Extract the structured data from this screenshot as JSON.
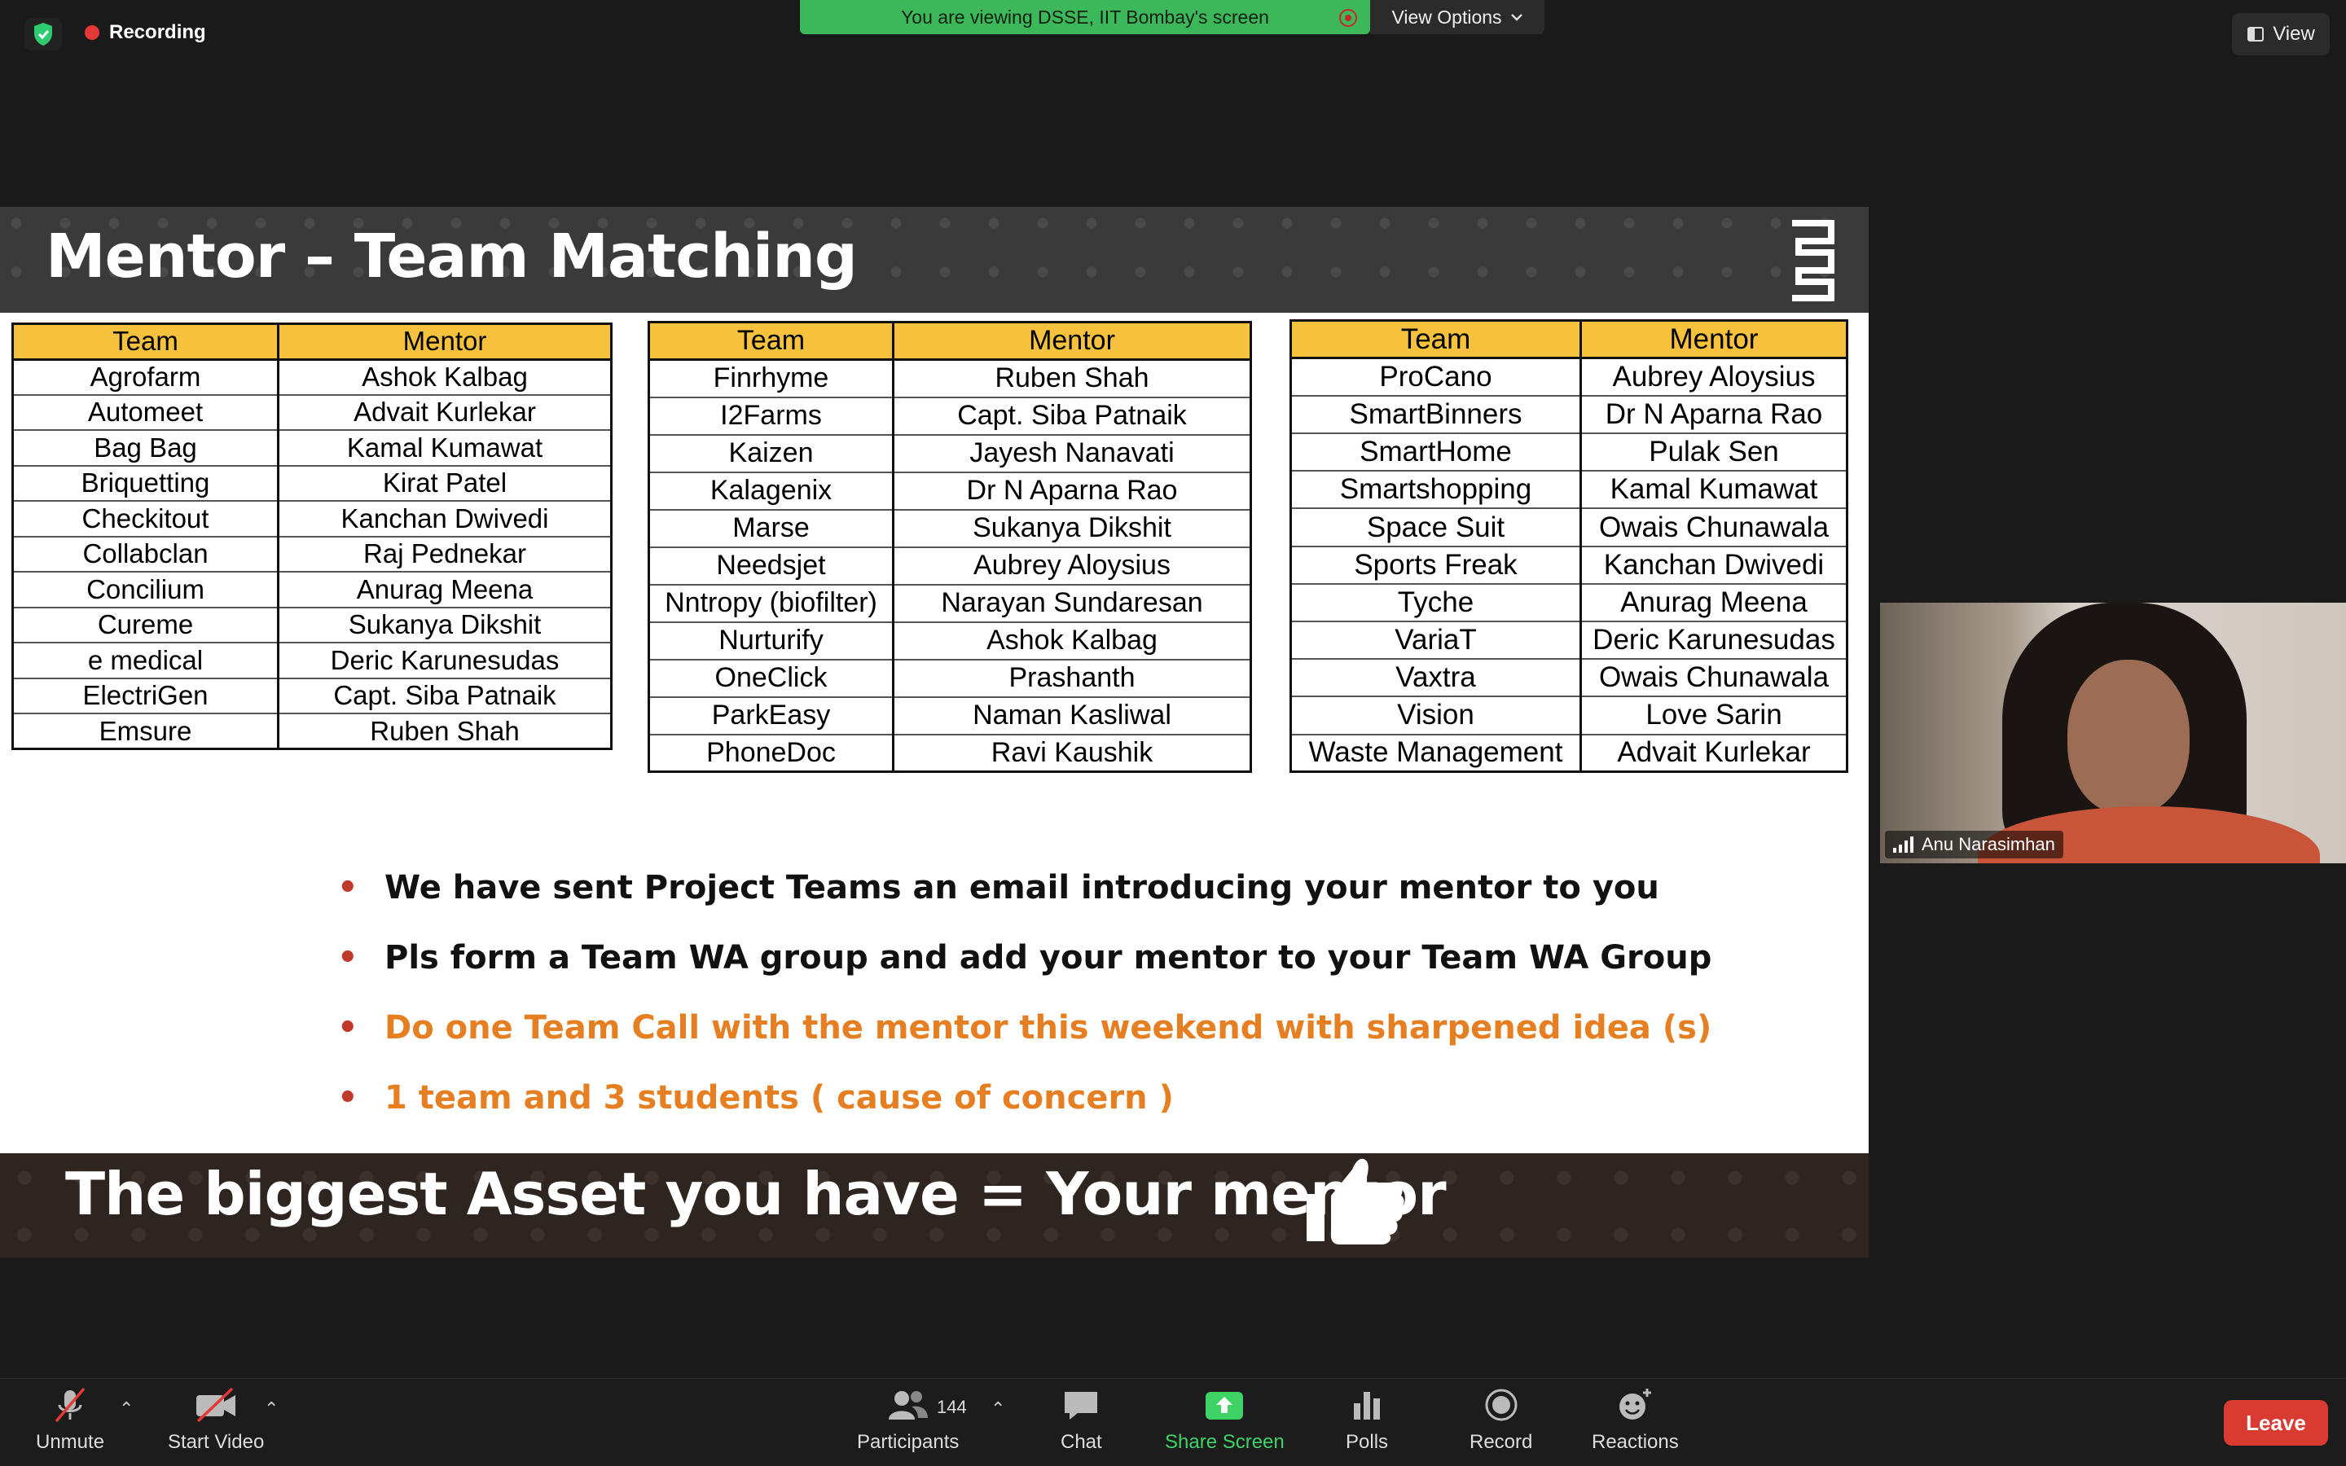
{
  "topbar": {
    "recording_label": "Recording",
    "viewing_banner": "You are viewing DSSE, IIT Bombay's screen",
    "view_options_label": "View Options",
    "view_label": "View"
  },
  "slide": {
    "title": "Mentor – Team Matching",
    "table_header_team": "Team",
    "table_header_mentor": "Mentor",
    "tables": [
      [
        [
          "Agrofarm",
          "Ashok Kalbag"
        ],
        [
          "Automeet",
          "Advait Kurlekar"
        ],
        [
          "Bag Bag",
          "Kamal Kumawat"
        ],
        [
          "Briquetting",
          "Kirat Patel"
        ],
        [
          "Checkitout",
          "Kanchan Dwivedi"
        ],
        [
          "Collabclan",
          "Raj Pednekar"
        ],
        [
          "Concilium",
          "Anurag Meena"
        ],
        [
          "Cureme",
          "Sukanya Dikshit"
        ],
        [
          "e medical",
          "Deric Karunesudas"
        ],
        [
          "ElectriGen",
          "Capt. Siba Patnaik"
        ],
        [
          "Emsure",
          "Ruben Shah"
        ]
      ],
      [
        [
          "Finrhyme",
          "Ruben Shah"
        ],
        [
          "I2Farms",
          "Capt. Siba  Patnaik"
        ],
        [
          "Kaizen",
          "Jayesh Nanavati"
        ],
        [
          "Kalagenix",
          "Dr N Aparna Rao"
        ],
        [
          "Marse",
          "Sukanya Dikshit"
        ],
        [
          "Needsjet",
          "Aubrey Aloysius"
        ],
        [
          "Nntropy (biofilter)",
          "Narayan Sundaresan"
        ],
        [
          "Nurturify",
          "Ashok Kalbag"
        ],
        [
          "OneClick",
          "Prashanth"
        ],
        [
          "ParkEasy",
          "Naman Kasliwal"
        ],
        [
          "PhoneDoc",
          "Ravi Kaushik"
        ]
      ],
      [
        [
          "ProCano",
          "Aubrey Aloysius"
        ],
        [
          "SmartBinners",
          "Dr N Aparna Rao"
        ],
        [
          "SmartHome",
          "Pulak Sen"
        ],
        [
          "Smartshopping",
          "Kamal Kumawat"
        ],
        [
          "Space Suit",
          "Owais Chunawala"
        ],
        [
          "Sports Freak",
          "Kanchan Dwivedi"
        ],
        [
          "Tyche",
          "Anurag Meena"
        ],
        [
          "VariaT",
          "Deric Karunesudas"
        ],
        [
          "Vaxtra",
          "Owais Chunawala"
        ],
        [
          "Vision",
          "Love Sarin"
        ],
        [
          "Waste Management",
          "Advait Kurlekar"
        ]
      ]
    ],
    "bullets": [
      {
        "text": "We have sent Project Teams an email introducing your mentor to you",
        "color": "#111111"
      },
      {
        "text": "Pls form a Team WA group and add your mentor to your Team WA Group",
        "color": "#111111"
      },
      {
        "text": "Do one Team Call with the mentor this weekend with sharpened idea (s)",
        "color": "#e67e22"
      },
      {
        "text": "1 team and 3 students ( cause of concern )",
        "color": "#e67e22"
      }
    ],
    "footer": "The biggest Asset you have = Your mentor",
    "header_color": "#3a3a3a",
    "table_header_color": "#f6c23e"
  },
  "participant": {
    "name": "Anu Narasimhan"
  },
  "toolbar": {
    "unmute": "Unmute",
    "start_video": "Start Video",
    "participants": "Participants",
    "participant_count": "144",
    "chat": "Chat",
    "share_screen": "Share Screen",
    "polls": "Polls",
    "record": "Record",
    "reactions": "Reactions",
    "leave": "Leave",
    "share_color": "#3fd267",
    "leave_color": "#d93b32"
  }
}
